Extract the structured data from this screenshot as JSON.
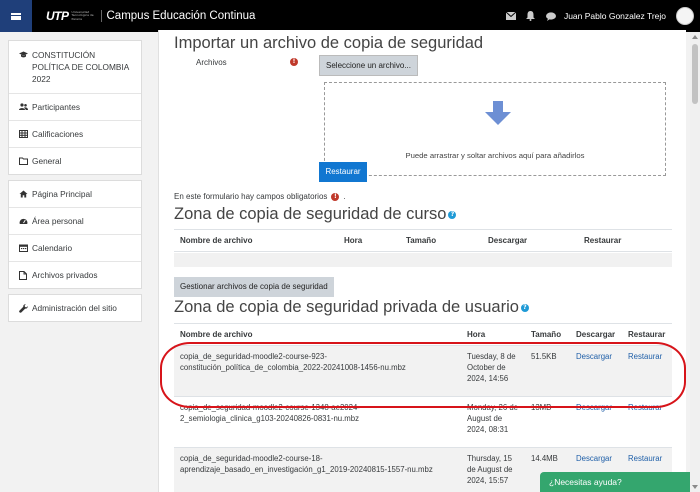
{
  "navbar": {
    "logo_text": "UTP",
    "logo_sub": "Universidad Tecnológica de Pereira",
    "title": "Campus Educación Continua",
    "user_name": "Juan Pablo Gonzalez Trejo",
    "icons": [
      "menu-icon",
      "mail-icon",
      "bell-icon",
      "chat-bubble-icon"
    ]
  },
  "sidebar": {
    "course": "CONSTITUCIÓN POLÍTICA DE COLOMBIA 2022",
    "course_items": [
      {
        "label": "Participantes",
        "icon": "users-icon"
      },
      {
        "label": "Calificaciones",
        "icon": "table-icon"
      },
      {
        "label": "General",
        "icon": "folder-icon"
      }
    ],
    "site_items": [
      {
        "label": "Página Principal",
        "icon": "home-icon"
      },
      {
        "label": "Área personal",
        "icon": "dashboard-icon"
      },
      {
        "label": "Calendario",
        "icon": "calendar-icon"
      },
      {
        "label": "Archivos privados",
        "icon": "file-icon"
      }
    ],
    "admin_item": {
      "label": "Administración del sitio",
      "icon": "wrench-icon"
    }
  },
  "import": {
    "title": "Importar un archivo de copia de seguridad",
    "files_label": "Archivos",
    "select_button": "Seleccione un archivo...",
    "drop_text": "Puede arrastrar y soltar archivos aquí para añadirlos",
    "restore_button": "Restaurar",
    "required_note": "En este formulario hay campos obligatorios",
    "required_suffix": "."
  },
  "course_backup": {
    "title": "Zona de copia de seguridad de curso",
    "columns": [
      "Nombre de archivo",
      "Hora",
      "Tamaño",
      "Descargar",
      "Restaurar"
    ]
  },
  "manage_button": "Gestionar archivos de copia de seguridad",
  "user_backup": {
    "title": "Zona de copia de seguridad privada de usuario",
    "columns": [
      "Nombre de archivo",
      "Hora",
      "Tamaño",
      "Descargar",
      "Restaurar"
    ],
    "rows": [
      {
        "filename": "copia_de_seguridad-moodle2-course-923-constitución_política_de_colombia_2022-20241008-1456-nu.mbz",
        "time": "Tuesday, 8 de October de 2024, 14:56",
        "size": "51.5KB",
        "download": "Descargar",
        "restore": "Restaurar"
      },
      {
        "filename": "copia_de_seguridad-moodle2-course-1348-ae2024-2_semiologia_clinica_g103-20240826-0831-nu.mbz",
        "time": "Monday, 26 de August de 2024, 08:31",
        "size": "13MB",
        "download": "Descargar",
        "restore": "Restaurar"
      },
      {
        "filename": "copia_de_seguridad-moodle2-course-18-aprendizaje_basado_en_investigación_g1_2019-20240815-1557-nu.mbz",
        "time": "Thursday, 15 de August de 2024, 15:57",
        "size": "14.4MB",
        "download": "Descargar",
        "restore": "Restaurar"
      }
    ]
  },
  "chat_button": "¿Necesitas ayuda?",
  "colors": {
    "navbar": "#000000",
    "hamburger": "#1f3f7a",
    "primary": "#1177d1",
    "chat": "#34a66e",
    "required": "#c0392b",
    "highlight": "#d7141a"
  }
}
